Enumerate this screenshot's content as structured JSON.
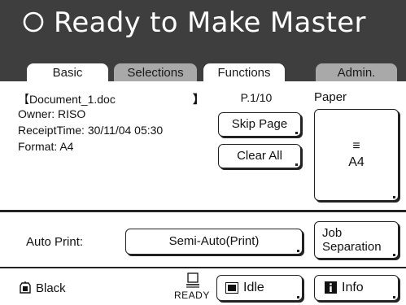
{
  "header": {
    "status": "Ready to Make Master",
    "status_icon": "circle-outline-icon",
    "background": "#3e3e3e"
  },
  "tabs": [
    {
      "label": "Basic",
      "active": true
    },
    {
      "label": "Selections",
      "active": false
    },
    {
      "label": "Functions",
      "active": false
    },
    {
      "label": "Admin.",
      "active": false
    }
  ],
  "document": {
    "title": "【Document_1.doc",
    "title_close": "】",
    "owner": "Owner: RISO",
    "receipt_time": "ReceiptTime: 30/11/04 05:30",
    "format": "Format: A4"
  },
  "page_indicator": "P.1/10",
  "buttons": {
    "skip_page": "Skip Page",
    "clear_all": "Clear All",
    "auto_print_value": "Semi-Auto(Print)",
    "job_separation_line1": "Job",
    "job_separation_line2": "Separation",
    "idle": "Idle",
    "info": "Info"
  },
  "paper": {
    "label": "Paper",
    "glyph": "≡",
    "value": "A4"
  },
  "auto_print_label": "Auto Print:",
  "footer": {
    "color": "Black",
    "color_icon": "ink-drum-icon",
    "ready": "READY",
    "ready_icon": "printer-ready-icon"
  }
}
